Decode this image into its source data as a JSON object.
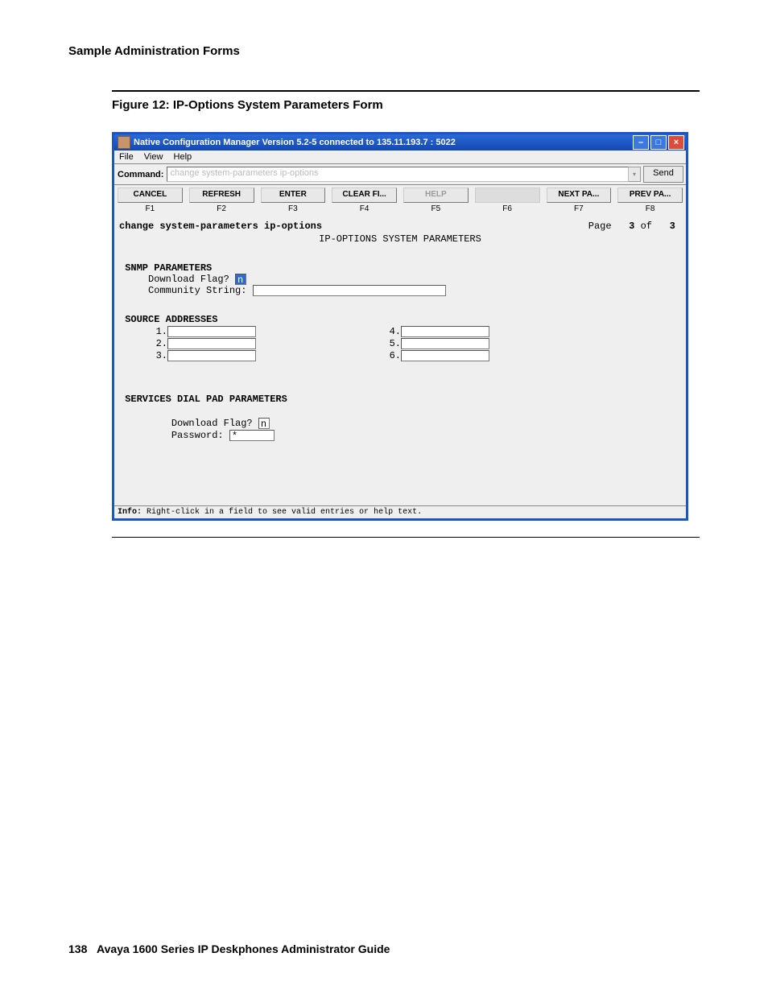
{
  "doc": {
    "section_header": "Sample Administration Forms",
    "figure_caption": "Figure 12: IP-Options System Parameters Form",
    "page_number": "138",
    "footer_title": "Avaya 1600 Series IP Deskphones Administrator Guide"
  },
  "window": {
    "title": "Native Configuration Manager Version 5.2-5 connected to 135.11.193.7 : 5022",
    "menus": [
      "File",
      "View",
      "Help"
    ],
    "command_label": "Command:",
    "command_value": "change system-parameters ip-options",
    "send_label": "Send",
    "toolbar": [
      {
        "label": "CANCEL",
        "fkey": "F1"
      },
      {
        "label": "REFRESH",
        "fkey": "F2"
      },
      {
        "label": "ENTER",
        "fkey": "F3"
      },
      {
        "label": "CLEAR  FI...",
        "fkey": "F4"
      },
      {
        "label": "HELP",
        "fkey": "F5"
      },
      {
        "label": "",
        "fkey": "F6"
      },
      {
        "label": "NEXT  PA...",
        "fkey": "F7"
      },
      {
        "label": "PREV  PA...",
        "fkey": "F8"
      }
    ],
    "info_label": "Info:",
    "info_text": " Right-click in a field to see valid entries or help text."
  },
  "term": {
    "cmd": "change system-parameters ip-options",
    "page_label": "Page",
    "page_cur": "3",
    "page_of": "of",
    "page_total": "3",
    "title": "IP-OPTIONS SYSTEM PARAMETERS",
    "snmp": {
      "header": "SNMP PARAMETERS",
      "dl_label": "Download Flag?",
      "dl_value": "n",
      "cs_label": "Community String:",
      "cs_value": ""
    },
    "src": {
      "header": "SOURCE ADDRESSES",
      "rows": [
        {
          "n": "1.",
          "v": ""
        },
        {
          "n": "2.",
          "v": ""
        },
        {
          "n": "3.",
          "v": ""
        },
        {
          "n": "4.",
          "v": ""
        },
        {
          "n": "5.",
          "v": ""
        },
        {
          "n": "6.",
          "v": ""
        }
      ]
    },
    "svc": {
      "header": "SERVICES DIAL PAD PARAMETERS",
      "dl_label": "Download Flag?",
      "dl_value": "n",
      "pw_label": "Password:",
      "pw_value": "*"
    }
  }
}
